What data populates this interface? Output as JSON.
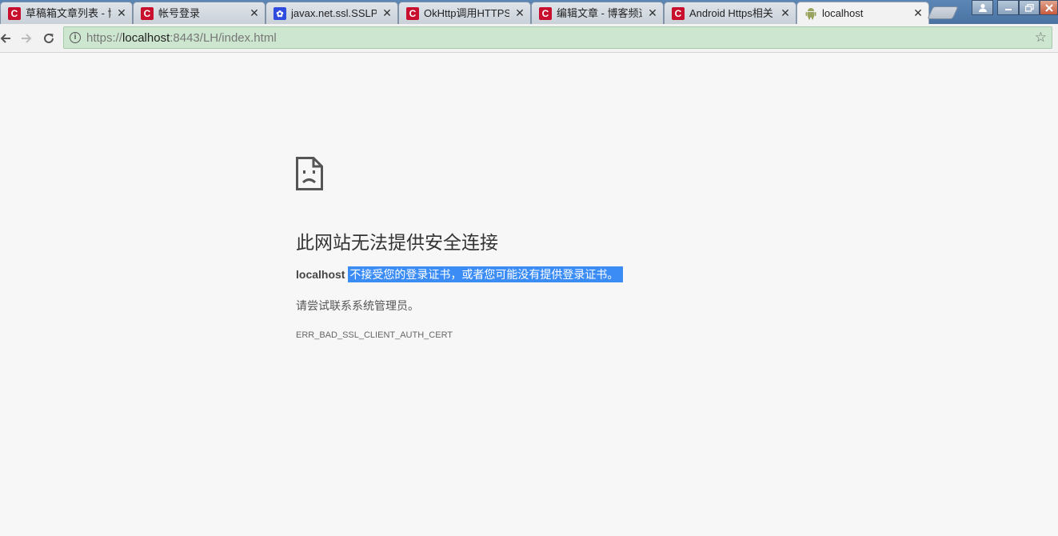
{
  "tabs": [
    {
      "title": "草稿箱文章列表 - 博",
      "favicon": "csdn-icon"
    },
    {
      "title": "帐号登录",
      "favicon": "csdn-icon"
    },
    {
      "title": "javax.net.ssl.SSLPe",
      "favicon": "paw-icon"
    },
    {
      "title": "OkHttp调用HTTPS",
      "favicon": "csdn-icon"
    },
    {
      "title": "编辑文章 - 博客频道",
      "favicon": "csdn-icon"
    },
    {
      "title": "Android Https相关",
      "favicon": "csdn-icon"
    },
    {
      "title": "localhost",
      "favicon": "android-icon",
      "active": true
    }
  ],
  "tab_close_glyph": "✕",
  "toolbar": {
    "url_scheme": "https://",
    "url_host": "localhost",
    "url_rest": ":8443/LH/index.html"
  },
  "error_page": {
    "heading": "此网站无法提供安全连接",
    "host": "localhost",
    "message": "不接受您的登录证书，或者您可能没有提供登录证书。",
    "hint": "请尝试联系系统管理员。",
    "error_code": "ERR_BAD_SSL_CLIENT_AUTH_CERT"
  },
  "colors": {
    "omnibox_bg": "#cde6d0",
    "selection": "#3b8cf5",
    "csdn_red": "#c8102e"
  }
}
